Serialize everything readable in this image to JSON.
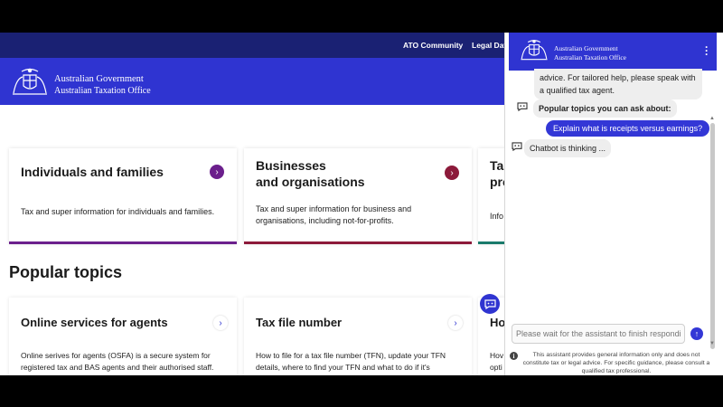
{
  "utility_nav": {
    "items": [
      "ATO Community",
      "Legal Dat"
    ]
  },
  "header": {
    "brand_line1": "Australian Government",
    "brand_line2": "Australian Taxation Office"
  },
  "audience_cards": [
    {
      "title": "Individuals and families",
      "desc": "Tax and super information for individuals and families.",
      "accent": "#6b1f8c"
    },
    {
      "title_line1": "Businesses",
      "title_line2": "and organisations",
      "desc_line1": "Tax and super information for business and",
      "desc_line2": "organisations, including not-for-profits.",
      "accent": "#8c1a3a"
    },
    {
      "title_line1": "Ta",
      "title_line2": "pro",
      "desc": "Info",
      "accent": "#1a7a6b"
    }
  ],
  "popular_topics": {
    "title": "Popular topics",
    "cards": [
      {
        "title": "Online services for agents",
        "desc_line1": "Online serives for agents (OSFA) is a secure system for",
        "desc_line2": "registered tax and BAS agents and their authorised staff."
      },
      {
        "title": "Tax file number",
        "desc_line1": "How to file for a tax file number (TFN), update your TFN",
        "desc_line2": "details, where to find your TFN and what to do if it's"
      },
      {
        "title": "Ho",
        "desc_line1": "Hov",
        "desc_line2": "opti"
      }
    ]
  },
  "chat": {
    "brand_line1": "Australian Government",
    "brand_line2": "Australian Taxation Office",
    "messages": {
      "bot_partial_line1": "advice. For tailored help, please speak with",
      "bot_partial_line2": "a qualified tax agent.",
      "popular_label": "Popular topics you can ask about:",
      "user_msg": "Explain what is receipts versus earnings?",
      "thinking": "Chatbot is thinking ..."
    },
    "input_placeholder": "Please wait for the assistant to finish responding",
    "disclaimer": "This assistant provides general information only and does not constitute tax or legal advice. For specific guidance, please consult a qualified tax professional."
  },
  "colors": {
    "brand_blue": "#2f34d1",
    "utility_navy": "#1a2173"
  }
}
